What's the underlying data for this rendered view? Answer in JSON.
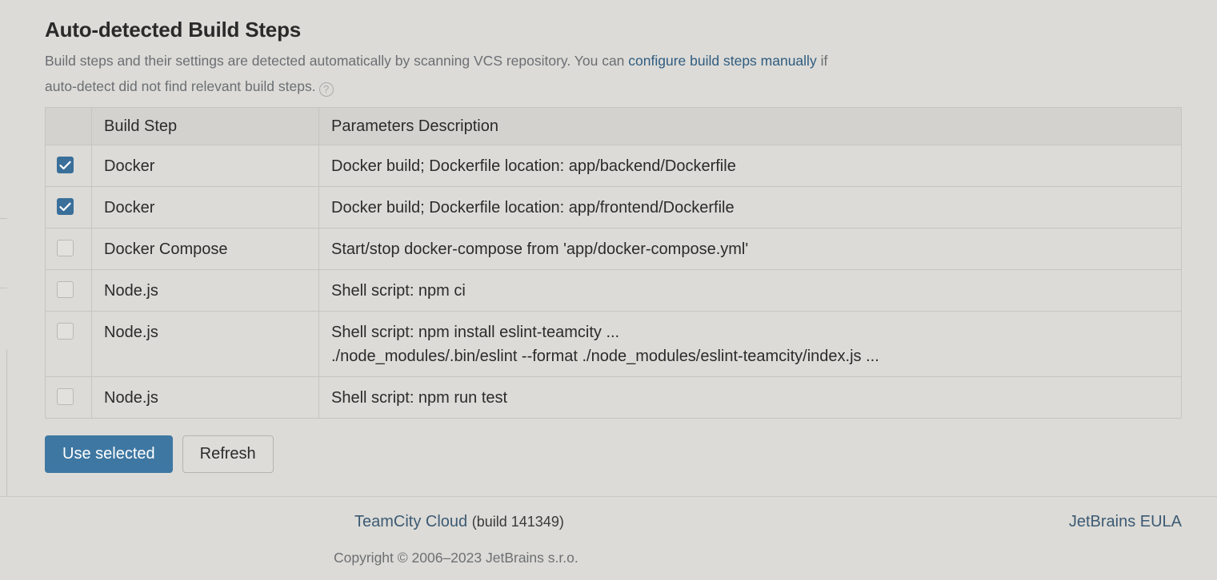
{
  "section": {
    "title": "Auto-detected Build Steps",
    "description_before": "Build steps and their settings are detected automatically by scanning VCS repository. You can ",
    "description_link": "configure build steps manually",
    "description_after": " if auto-detect did not find relevant build steps.",
    "help_icon": "question-circle-icon"
  },
  "table": {
    "headers": [
      "",
      "Build Step",
      "Parameters Description"
    ],
    "rows": [
      {
        "checked": true,
        "step": "Docker",
        "params": [
          "Docker build; Dockerfile location: app/backend/Dockerfile"
        ]
      },
      {
        "checked": true,
        "step": "Docker",
        "params": [
          "Docker build; Dockerfile location: app/frontend/Dockerfile"
        ]
      },
      {
        "checked": false,
        "step": "Docker Compose",
        "params": [
          "Start/stop docker-compose from 'app/docker-compose.yml'"
        ]
      },
      {
        "checked": false,
        "step": "Node.js",
        "params": [
          "Shell script: npm ci"
        ]
      },
      {
        "checked": false,
        "step": "Node.js",
        "params": [
          "Shell script: npm install eslint-teamcity ...",
          "./node_modules/.bin/eslint --format ./node_modules/eslint-teamcity/index.js ..."
        ]
      },
      {
        "checked": false,
        "step": "Node.js",
        "params": [
          "Shell script: npm run test"
        ]
      }
    ]
  },
  "actions": {
    "use_selected": "Use selected",
    "refresh": "Refresh"
  },
  "footer": {
    "product": "TeamCity Cloud",
    "build": "(build 141349)",
    "eula": "JetBrains EULA",
    "copyright": "Copyright © 2006–2023 JetBrains s.r.o."
  },
  "colors": {
    "accent": "#3e77a2",
    "link": "#2f5c80",
    "background": "#dcdbd7"
  }
}
